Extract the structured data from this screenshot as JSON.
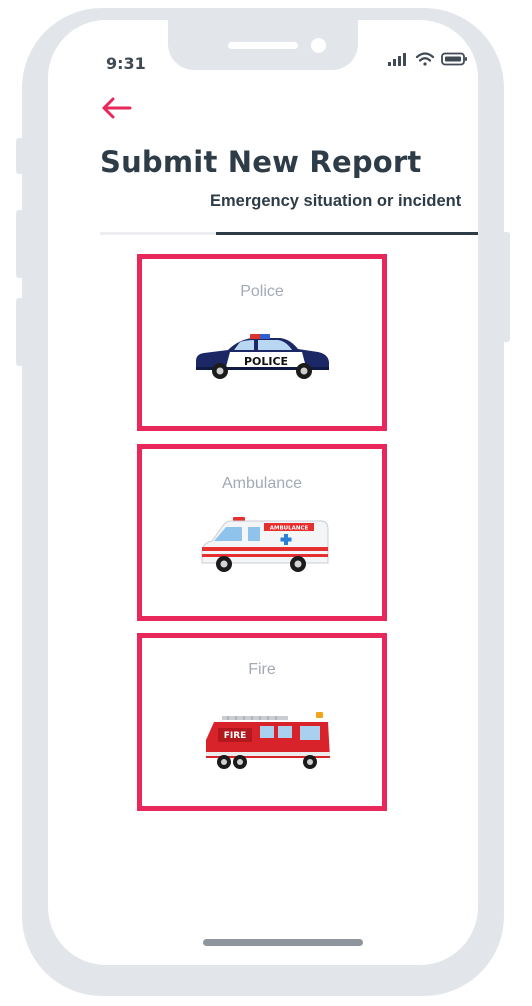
{
  "status_bar": {
    "time": "9:31",
    "icons": [
      "signal-icon",
      "wifi-icon",
      "battery-icon"
    ]
  },
  "header": {
    "back_icon": "arrow-left-icon",
    "title": "Submit New Report",
    "step_label": "Emergency situation or incident"
  },
  "options": [
    {
      "label": "Police",
      "icon": "police-car-icon",
      "vehicle_text": "POLICE"
    },
    {
      "label": "Ambulance",
      "icon": "ambulance-icon",
      "vehicle_text": "AMBULANCE"
    },
    {
      "label": "Fire",
      "icon": "fire-truck-icon",
      "vehicle_text": "FIRE"
    }
  ],
  "colors": {
    "accent": "#e8275a",
    "title": "#2e3c48",
    "muted_label": "#a3aab3",
    "frame": "#e2e5e9"
  }
}
